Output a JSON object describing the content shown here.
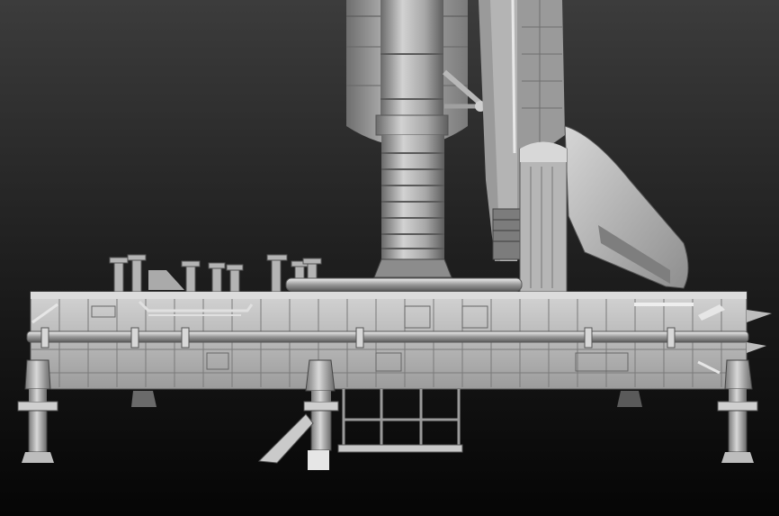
{
  "scene": {
    "subject": "launch-platform-render",
    "colors": {
      "bg_top": "#3a3a3a",
      "bg_bottom": "#050505",
      "metal_light": "#c8c8c8",
      "metal_mid": "#9a9a9a",
      "metal_dark": "#5a5a5a",
      "shadow": "#2a2a2a"
    }
  }
}
